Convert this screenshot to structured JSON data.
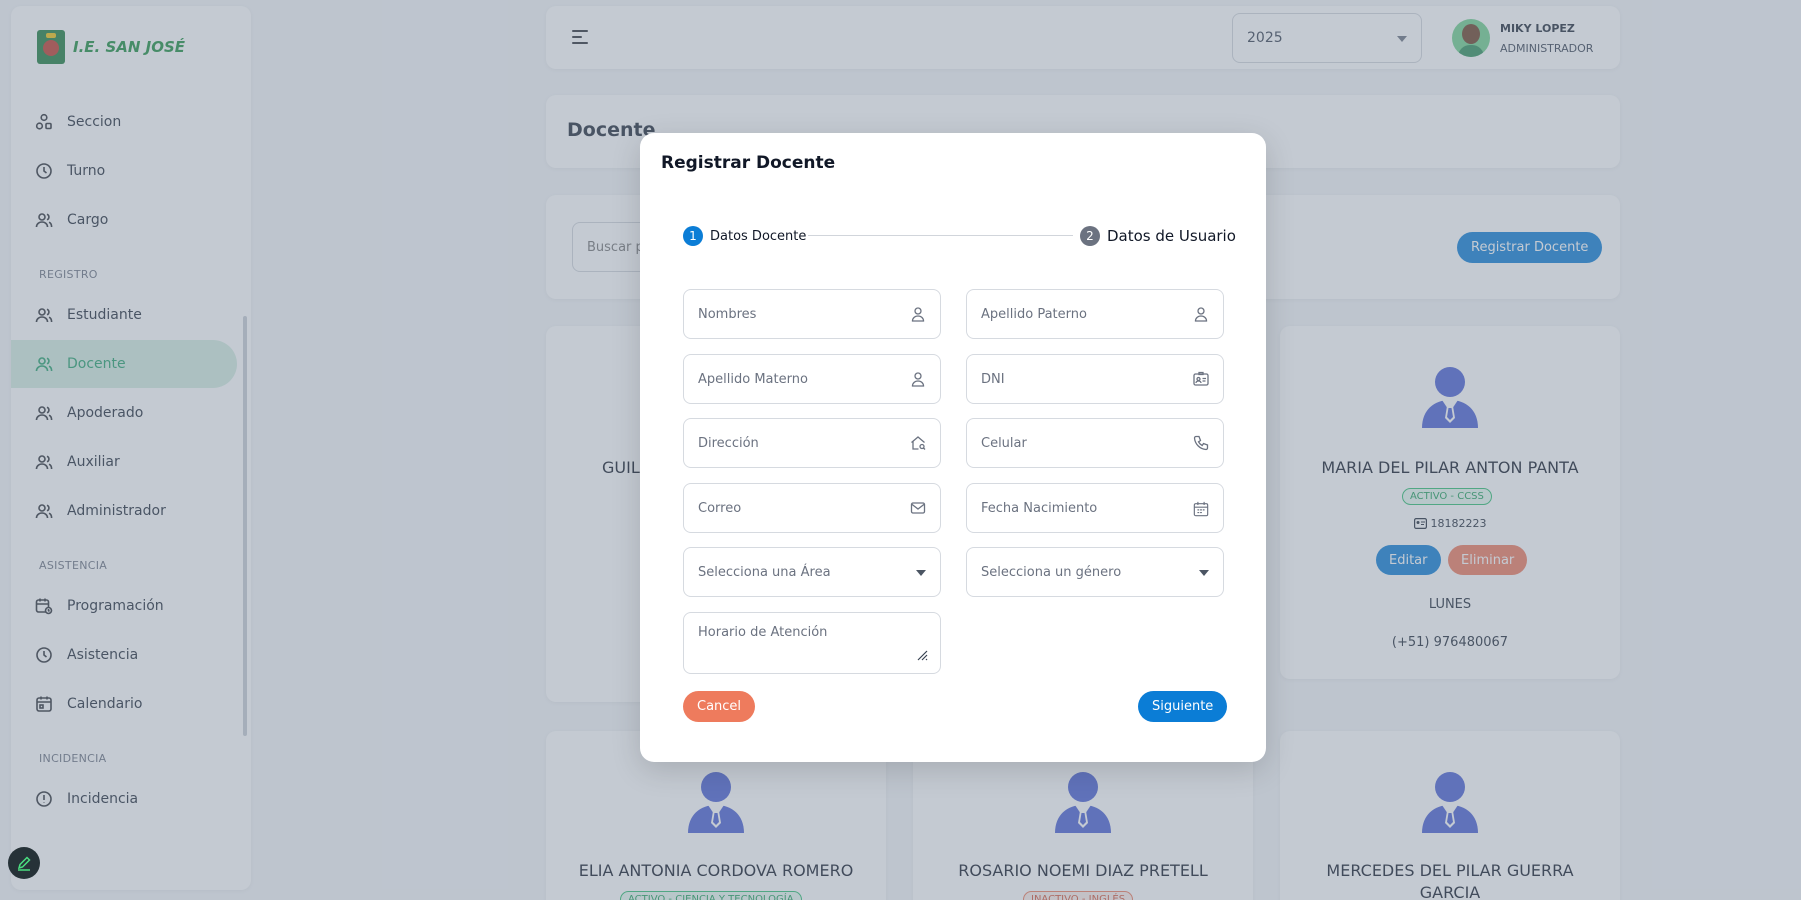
{
  "brand": {
    "name": "I.E. SAN JOSÉ"
  },
  "sidebar": {
    "items_top": [
      {
        "label": "Seccion",
        "icon": "shapes-icon"
      },
      {
        "label": "Turno",
        "icon": "clock-icon"
      },
      {
        "label": "Cargo",
        "icon": "users-icon"
      }
    ],
    "group_registro": "REGISTRO",
    "items_registro": [
      {
        "label": "Estudiante",
        "icon": "users-icon"
      },
      {
        "label": "Docente",
        "icon": "users-icon",
        "active": true
      },
      {
        "label": "Apoderado",
        "icon": "users-icon"
      },
      {
        "label": "Auxiliar",
        "icon": "users-icon"
      },
      {
        "label": "Administrador",
        "icon": "users-icon"
      }
    ],
    "group_asistencia": "ASISTENCIA",
    "items_asistencia": [
      {
        "label": "Programación",
        "icon": "calendar-clock-icon"
      },
      {
        "label": "Asistencia",
        "icon": "clock-icon"
      },
      {
        "label": "Calendario",
        "icon": "calendar-icon"
      }
    ],
    "group_incidencia": "INCIDENCIA",
    "items_incidencia": [
      {
        "label": "Incidencia",
        "icon": "alert-icon"
      }
    ]
  },
  "header": {
    "year": "2025",
    "user_name": "MIKY LOPEZ",
    "user_role": "ADMINISTRADOR"
  },
  "page": {
    "title": "Docente",
    "search_placeholder": "Buscar p",
    "register_label": "Registrar Docente"
  },
  "teachers": {
    "partial_name": "GUIL",
    "card_right": {
      "name": "MARIA DEL PILAR ANTON PANTA",
      "status": "ACTIVO - CCSS",
      "dni": "18182223",
      "edit": "Editar",
      "delete": "Eliminar",
      "day": "LUNES",
      "phone": "(+51) 976480067"
    },
    "bottom": [
      {
        "name": "ELIA ANTONIA CORDOVA ROMERO",
        "status": "ACTIVO - CIENCIA Y TECNOLOGÍA"
      },
      {
        "name": "ROSARIO NOEMI DIAZ PRETELL",
        "status": "INACTIVO - INGLÉS"
      },
      {
        "name_line1": "MERCEDES DEL PILAR GUERRA",
        "name_line2": "GARCIA"
      }
    ]
  },
  "modal": {
    "title": "Registrar Docente",
    "step1_num": "1",
    "step1_label": "Datos Docente",
    "step2_num": "2",
    "step2_label": "Datos de Usuario",
    "fields": {
      "nombres": "Nombres",
      "apellido_paterno": "Apellido Paterno",
      "apellido_materno": "Apellido Materno",
      "dni": "DNI",
      "direccion": "Dirección",
      "celular": "Celular",
      "correo": "Correo",
      "fecha_nacimiento": "Fecha Nacimiento",
      "area": "Selecciona una Área",
      "genero": "Selecciona un género",
      "horario": "Horario de Atención"
    },
    "cancel": "Cancel",
    "next": "Siguiente"
  },
  "colors": {
    "primary": "#0b7dd6",
    "danger": "#ee7b5d",
    "active_green": "#23a06b",
    "person_icon": "#4a5fd3"
  }
}
